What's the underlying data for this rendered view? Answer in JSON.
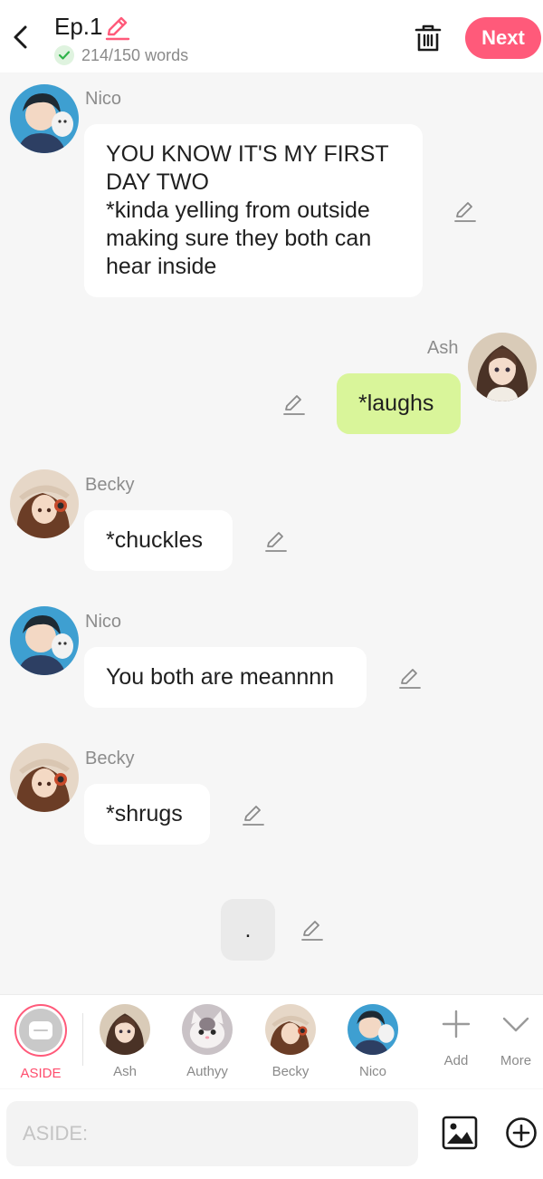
{
  "header": {
    "episode_title": "Ep.1",
    "word_count": "214/150 words",
    "next_label": "Next"
  },
  "messages": [
    {
      "speaker": "Nico",
      "side": "left",
      "text": "YOU KNOW IT'S MY FIRST DAY TWO\n*kinda yelling from outside making sure they both can hear inside"
    },
    {
      "speaker": "Ash",
      "side": "right",
      "text": "*laughs"
    },
    {
      "speaker": "Becky",
      "side": "left",
      "text": "*chuckles"
    },
    {
      "speaker": "Nico",
      "side": "left",
      "text": "You both are meannnn"
    },
    {
      "speaker": "Becky",
      "side": "left",
      "text": "*shrugs"
    },
    {
      "speaker": "",
      "side": "aside",
      "text": "."
    }
  ],
  "characters": [
    {
      "name": "ASIDE",
      "selected": true,
      "icon": "aside-bubble-icon"
    },
    {
      "name": "Ash"
    },
    {
      "name": "Authyy"
    },
    {
      "name": "Becky"
    },
    {
      "name": "Nico"
    },
    {
      "name": "Add",
      "icon": "plus-icon"
    },
    {
      "name": "More",
      "icon": "chevron-down-icon"
    }
  ],
  "input": {
    "placeholder": "ASIDE:"
  },
  "colors": {
    "accent": "#ff5a7a",
    "my_bubble": "#d9f59a",
    "other_bubble": "#ffffff",
    "background": "#f6f6f6"
  }
}
